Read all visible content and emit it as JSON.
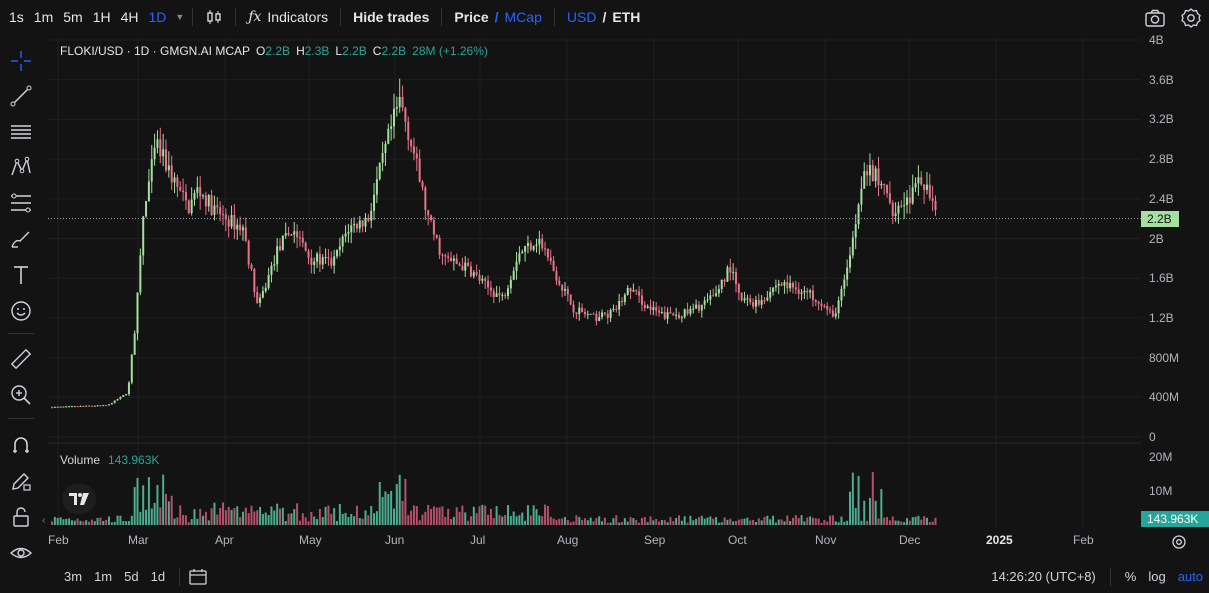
{
  "topbar": {
    "timeframes": [
      "1s",
      "1m",
      "5m",
      "1H",
      "4H",
      "1D"
    ],
    "active_timeframe": "1D",
    "indicators_label": "Indicators",
    "hide_trades_label": "Hide trades",
    "price_label": "Price",
    "price_sep": "/",
    "mcap_label": "MCap",
    "usd_label": "USD",
    "currency_sep": "/",
    "eth_label": "ETH"
  },
  "legend": {
    "symbol": "FLOKI/USD · 1D · GMGN.AI MCAP",
    "o_key": "O",
    "o_val": "2.2B",
    "h_key": "H",
    "h_val": "2.3B",
    "l_key": "L",
    "l_val": "2.2B",
    "c_key": "C",
    "c_val": "2.2B",
    "change": "28M (+1.26%)"
  },
  "volume_legend": {
    "label": "Volume",
    "value": "143.963K"
  },
  "price_axis": [
    "4B",
    "3.6B",
    "3.2B",
    "2.8B",
    "2.4B",
    "2B",
    "1.6B",
    "1.2B",
    "800M",
    "400M",
    "0"
  ],
  "volume_axis": [
    "20M",
    "10M"
  ],
  "current_price_tag": "2.2B",
  "current_volume_tag": "143.963K",
  "time_axis": [
    "Feb",
    "Mar",
    "Apr",
    "May",
    "Jun",
    "Jul",
    "Aug",
    "Sep",
    "Oct",
    "Nov",
    "Dec",
    "2025",
    "Feb"
  ],
  "bottombar": {
    "ranges": [
      "3m",
      "1m",
      "5d",
      "1d"
    ],
    "clock": "14:26:20 (UTC+8)",
    "percent": "%",
    "log": "log",
    "auto": "auto"
  },
  "colors": {
    "up": "#a5e0a0",
    "down": "#e8738a",
    "accent": "#2962ff",
    "vol_up": "#4cae8f",
    "vol_down": "#b4506a"
  },
  "chart_data": {
    "type": "candlestick",
    "ylim": [
      0,
      4000000000
    ],
    "y_unit": "USD market cap",
    "closes_monthly_approx": [
      {
        "month": "Feb",
        "value": 300000000
      },
      {
        "month": "Mar",
        "value": 2800000000
      },
      {
        "month": "Apr",
        "value": 2300000000
      },
      {
        "month": "May",
        "value": 1800000000
      },
      {
        "month": "Jun",
        "value": 3300000000
      },
      {
        "month": "Jul",
        "value": 1700000000
      },
      {
        "month": "Aug",
        "value": 1200000000
      },
      {
        "month": "Sep",
        "value": 1300000000
      },
      {
        "month": "Oct",
        "value": 1400000000
      },
      {
        "month": "Nov",
        "value": 1600000000
      },
      {
        "month": "Dec",
        "value": 2200000000
      }
    ],
    "last_close": 2200000000
  }
}
